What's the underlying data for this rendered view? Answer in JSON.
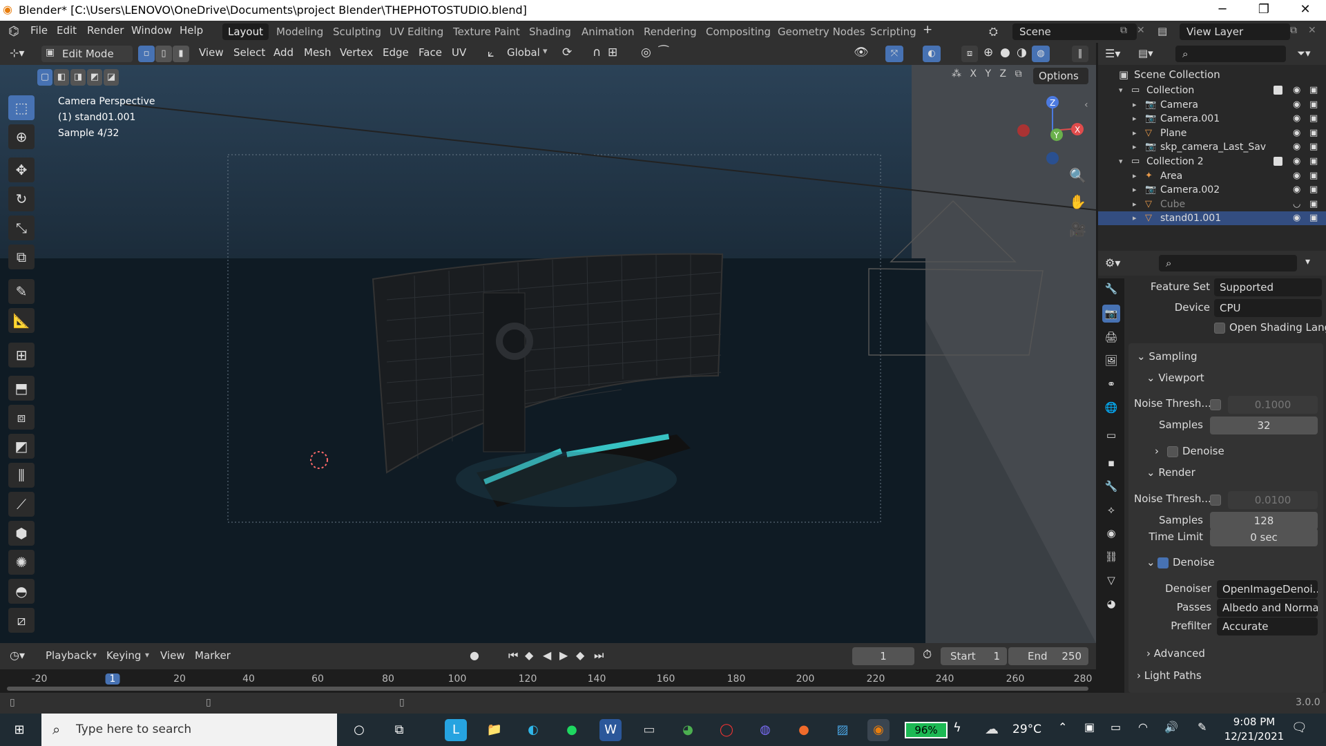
{
  "window": {
    "title": "Blender* [C:\\Users\\LENOVO\\OneDrive\\Documents\\project Blender\\THEPHOTOSTUDIO.blend]",
    "minimize": "─",
    "maximize": "❐",
    "close": "✕"
  },
  "menu": {
    "items": [
      "File",
      "Edit",
      "Render",
      "Window",
      "Help"
    ],
    "workspaces": [
      "Layout",
      "Modeling",
      "Sculpting",
      "UV Editing",
      "Texture Paint",
      "Shading",
      "Animation",
      "Rendering",
      "Compositing",
      "Geometry Nodes",
      "Scripting"
    ],
    "active_workspace": "Layout",
    "add_workspace": "+",
    "scene": "Scene",
    "view_layer": "View Layer"
  },
  "header3d": {
    "mode": "Edit Mode",
    "menus": [
      "View",
      "Select",
      "Add",
      "Mesh",
      "Vertex",
      "Edge",
      "Face",
      "UV"
    ],
    "transform_orientation": "Global",
    "options": "Options",
    "axes": [
      "X",
      "Y",
      "Z"
    ]
  },
  "viewport": {
    "line1": "Camera Perspective",
    "line2": "(1) stand01.001",
    "line3": "Sample 4/32",
    "gizmo": {
      "z": "Z",
      "y": "Y",
      "x": "X"
    }
  },
  "timeline": {
    "menus": [
      "Playback",
      "Keying",
      "View",
      "Marker"
    ],
    "current_frame": "1",
    "start_label": "Start",
    "start": "1",
    "end_label": "End",
    "end": "250",
    "ticks": [
      "-20",
      "1",
      "20",
      "40",
      "60",
      "80",
      "100",
      "120",
      "140",
      "160",
      "180",
      "200",
      "220",
      "240",
      "260",
      "280"
    ],
    "current_tick": "1"
  },
  "statusbar": {
    "version": "3.0.0"
  },
  "outliner": {
    "root": "Scene Collection",
    "rows": [
      {
        "label": "Collection",
        "indent": 1,
        "kind": "collection"
      },
      {
        "label": "Camera",
        "indent": 2,
        "kind": "camera"
      },
      {
        "label": "Camera.001",
        "indent": 2,
        "kind": "camera"
      },
      {
        "label": "Plane",
        "indent": 2,
        "kind": "mesh"
      },
      {
        "label": "skp_camera_Last_Sav",
        "indent": 2,
        "kind": "camera"
      },
      {
        "label": "Collection 2",
        "indent": 1,
        "kind": "collection"
      },
      {
        "label": "Area",
        "indent": 2,
        "kind": "light"
      },
      {
        "label": "Camera.002",
        "indent": 2,
        "kind": "camera"
      },
      {
        "label": "Cube",
        "indent": 2,
        "kind": "mesh"
      },
      {
        "label": "stand01.001",
        "indent": 2,
        "kind": "mesh"
      }
    ]
  },
  "properties": {
    "feature_set_label": "Feature Set",
    "feature_set": "Supported",
    "device_label": "Device",
    "device": "CPU",
    "osl_label": "Open Shading Lang...",
    "sampling": "Sampling",
    "viewport_panel": "Viewport",
    "vp_noise_label": "Noise Thresh...",
    "vp_noise": "0.1000",
    "vp_samples_label": "Samples",
    "vp_samples": "32",
    "vp_denoise": "Denoise",
    "render_panel": "Render",
    "r_noise_label": "Noise Thresh...",
    "r_noise": "0.0100",
    "r_samples_label": "Samples",
    "r_samples": "128",
    "time_limit_label": "Time Limit",
    "time_limit": "0 sec",
    "r_denoise": "Denoise",
    "denoiser_label": "Denoiser",
    "denoiser": "OpenImageDenoi...",
    "passes_label": "Passes",
    "passes": "Albedo and Normal",
    "prefilter_label": "Prefilter",
    "prefilter": "Accurate",
    "advanced": "Advanced",
    "light_paths": "Light Paths"
  },
  "taskbar": {
    "search_placeholder": "Type here to search",
    "battery": "96%",
    "temp": "29°C",
    "time": "9:08 PM",
    "date": "12/21/2021"
  },
  "colors": {
    "accent": "#4772b3",
    "selected_row": "#334d80",
    "led_cyan": "#3fe0e0"
  }
}
